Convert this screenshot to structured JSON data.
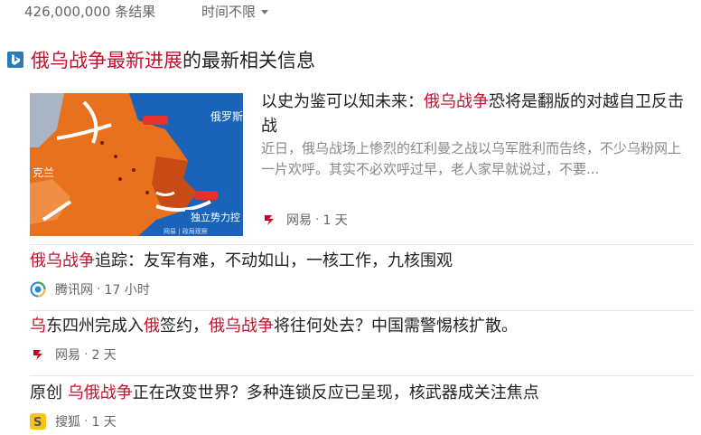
{
  "topbar": {
    "result_count": "426,000,000 条结果",
    "time_filter": "时间不限"
  },
  "news_header": {
    "title_hl1": "俄乌战争",
    "title_hl2": "最新进展",
    "title_rest": "的最新相关信息"
  },
  "featured": {
    "image_labels": {
      "ukraine_frag": "克兰",
      "russia_frag": "俄罗斯",
      "independent": "独立势力控",
      "credit": "网易 | 政局观察"
    },
    "title_pre": "以史为鉴可以知未来：",
    "title_hl": "俄乌战争",
    "title_post": "恐将是翻版的对越自卫反击战",
    "snippet": "近日，俄乌战场上惨烈的红利曼之战以乌军胜利而告终，不少乌粉网上一片欢呼。其实不必欢呼过早，老人家早就说过，不要...",
    "source": "网易",
    "time": "1 天"
  },
  "items": [
    {
      "pre": "",
      "hl1": "俄乌战争",
      "mid": "追踪：友军有难，不动如山，一核工作，九核围观",
      "hl2": "",
      "post": "",
      "source": "腾讯网",
      "time": "17 小时"
    },
    {
      "pre": "",
      "hl1": "乌",
      "mid": "东四州完成入",
      "hl2": "俄",
      "mid2": "签约，",
      "hl3": "俄乌战争",
      "post": "将往何处去？中国需警惕核扩散。",
      "source": "网易",
      "time": "2 天"
    },
    {
      "pre": "原创 ",
      "hl1": "乌俄战争",
      "mid": "正在改变世界？多种连锁反应已呈现，核武器成关注焦点",
      "source": "搜狐",
      "time": "1 天"
    }
  ],
  "colors": {
    "highlight": "#c8102e",
    "bing_blue": "#2b7bb9",
    "netease_red": "#d0021b",
    "map_orange": "#e8711e",
    "map_blue": "#1a63b8"
  }
}
